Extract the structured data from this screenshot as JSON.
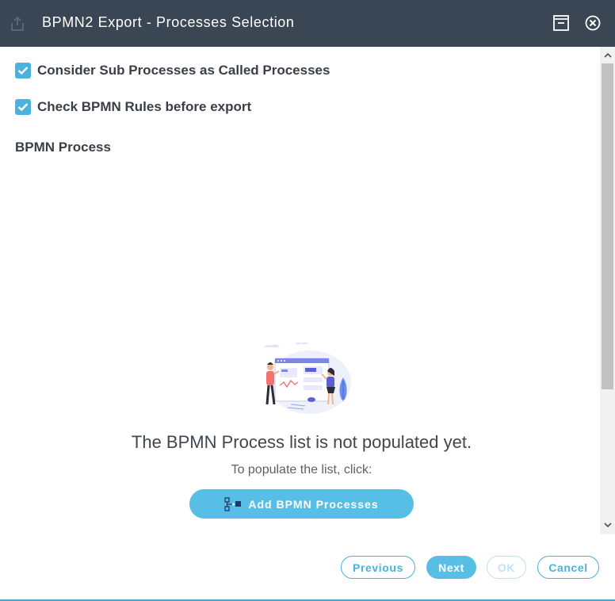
{
  "window": {
    "title": "BPMN2 Export - Processes Selection",
    "icons": {
      "app": "export-icon",
      "minimize": "minimize-icon",
      "close": "close-icon"
    }
  },
  "options": {
    "sub_processes": {
      "label": "Consider Sub Processes as Called Processes",
      "checked": true
    },
    "check_rules": {
      "label": "Check BPMN Rules before export",
      "checked": true
    }
  },
  "section": {
    "label": "BPMN Process"
  },
  "empty_state": {
    "illustration": "empty-list-illustration",
    "title": "The BPMN Process list is not populated yet.",
    "subtitle": "To populate the list, click:",
    "add_button_label": "Add BPMN Processes",
    "add_button_icon": "add-processes-icon"
  },
  "footer": {
    "previous_label": "Previous",
    "next_label": "Next",
    "ok_label": "OK",
    "cancel_label": "Cancel"
  },
  "colors": {
    "titlebar": "#3b4654",
    "accent": "#57bfe6",
    "checkbox": "#4ab3dd",
    "disabled": "#bde3f2"
  }
}
